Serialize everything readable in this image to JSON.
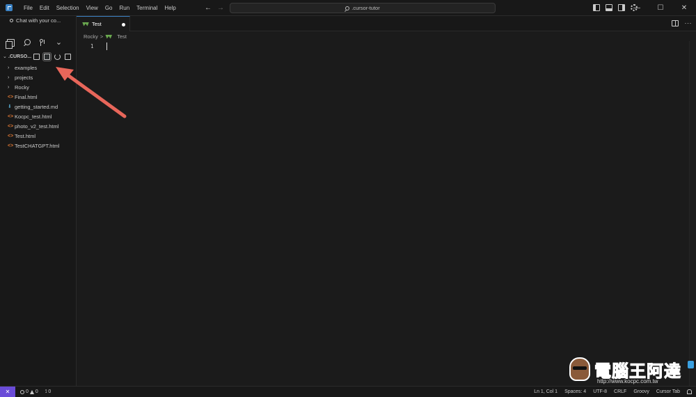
{
  "titlebar": {
    "menu": [
      "File",
      "Edit",
      "Selection",
      "View",
      "Go",
      "Run",
      "Terminal",
      "Help"
    ],
    "search_text": ".cursor-tutor",
    "window_controls": [
      "—",
      "☐",
      "✕"
    ]
  },
  "sidebar": {
    "chat_label": "Chat with your co...",
    "explorer_folder": ".CURSO...",
    "tree": [
      {
        "type": "folder",
        "label": "examples"
      },
      {
        "type": "folder",
        "label": "projects"
      },
      {
        "type": "folder",
        "label": "Rocky"
      },
      {
        "type": "html",
        "label": "Final.html"
      },
      {
        "type": "md",
        "label": "getting_started.md"
      },
      {
        "type": "html",
        "label": "Kocpc_test.html"
      },
      {
        "type": "html",
        "label": "photo_v2_test.html"
      },
      {
        "type": "html",
        "label": "Test.html"
      },
      {
        "type": "html",
        "label": "TestCHATGPT.html"
      }
    ]
  },
  "tabs": [
    {
      "label": "Test",
      "dirty": true
    }
  ],
  "breadcrumb": {
    "folder": "Rocky",
    "separator": ">",
    "file": "Test"
  },
  "editor": {
    "line_number": "1"
  },
  "watermark": {
    "title": "電腦王阿達",
    "url": "http://www.kocpc.com.tw"
  },
  "statusbar": {
    "remote": "✕",
    "errors": "0",
    "warnings": "0",
    "ports": "0",
    "position": "Ln 1, Col 1",
    "spaces": "Spaces: 4",
    "encoding": "UTF-8",
    "eol": "CRLF",
    "language": "Groovy",
    "cursor_tab": "Cursor Tab"
  },
  "colors": {
    "accent": "#3b82c4",
    "annotation_arrow": "#e8665a",
    "remote_button": "#6a4cd8",
    "html_icon": "#e37933",
    "md_icon": "#519aba",
    "groovy_icon": "#6aa84f"
  }
}
